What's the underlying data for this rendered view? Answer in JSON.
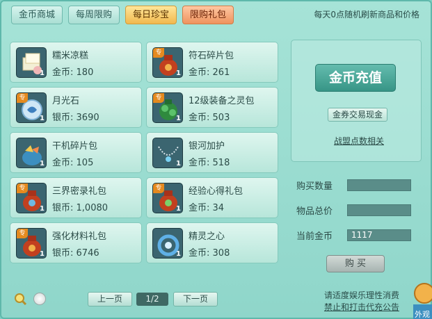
{
  "tabs": [
    "金币商城",
    "每周限购",
    "每日珍宝",
    "限购礼包"
  ],
  "active_tab": "每日珍宝",
  "top_notice": "每天0点随机刷新商品和价格",
  "items": [
    {
      "name": "糯米凉糕",
      "currency": "金币",
      "price": "180",
      "special": "",
      "qty": "1",
      "icon": "rice-cake-icon"
    },
    {
      "name": "符石碎片包",
      "currency": "金币",
      "price": "261",
      "special": "专",
      "qty": "1",
      "icon": "rune-bag-icon"
    },
    {
      "name": "月光石",
      "currency": "银币",
      "price": "3690",
      "special": "专",
      "qty": "1",
      "icon": "moonstone-icon"
    },
    {
      "name": "12级装备之灵包",
      "currency": "金币",
      "price": "503",
      "special": "专",
      "qty": "1",
      "icon": "equipment-spirit-bag-icon"
    },
    {
      "name": "干机碎片包",
      "currency": "金币",
      "price": "105",
      "special": "",
      "qty": "1",
      "icon": "fragment-bag-icon"
    },
    {
      "name": "银河加护",
      "currency": "金币",
      "price": "518",
      "special": "",
      "qty": "1",
      "icon": "necklace-icon"
    },
    {
      "name": "三界密录礼包",
      "currency": "银币",
      "price": "1,0080",
      "special": "专",
      "qty": "1",
      "icon": "gift-bag-icon"
    },
    {
      "name": "经验心得礼包",
      "currency": "金币",
      "price": "34",
      "special": "专",
      "qty": "1",
      "icon": "gift-bag-icon"
    },
    {
      "name": "强化材料礼包",
      "currency": "银币",
      "price": "6746",
      "special": "专",
      "qty": "1",
      "icon": "gift-bag-icon"
    },
    {
      "name": "精灵之心",
      "currency": "金币",
      "price": "308",
      "special": "",
      "qty": "1",
      "icon": "spirit-heart-icon"
    }
  ],
  "panel": {
    "recharge": "金币充值",
    "exchange": "金券交易现金",
    "alliance": "战盟点数相关"
  },
  "fields": {
    "buy_qty_label": "购买数量",
    "buy_qty_value": "",
    "total_label": "物品总价",
    "total_value": "",
    "current_gold_label": "当前金币",
    "current_gold_value": "1117"
  },
  "buy_label": "购 买",
  "pagination": {
    "prev": "上一页",
    "page": "1/2",
    "next": "下一页"
  },
  "bottom_notice": {
    "line1": "请适度娱乐理性消费",
    "line2": "禁止和打击代充公告"
  },
  "exterior_label": "外观"
}
